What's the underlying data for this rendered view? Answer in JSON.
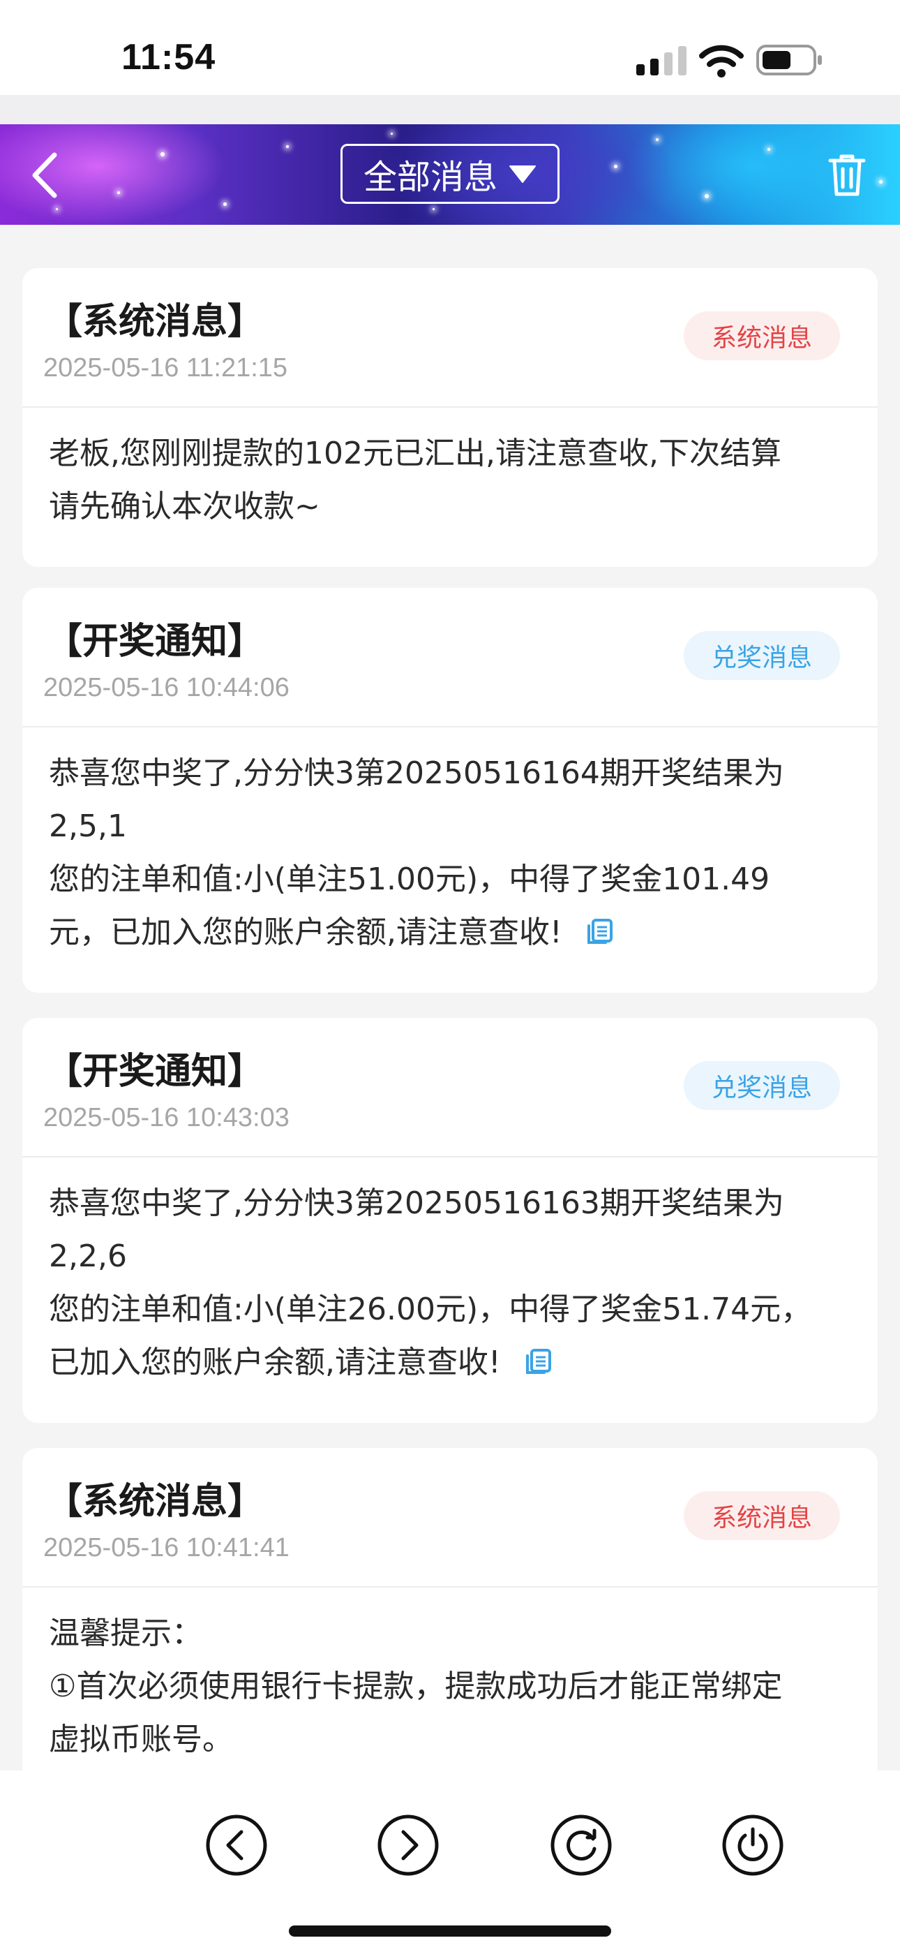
{
  "status_bar": {
    "time": "11:54",
    "signal_icon": "cellular-signal-icon",
    "wifi_icon": "wifi-icon",
    "battery_icon": "battery-icon"
  },
  "header": {
    "back_icon": "chevron-left-icon",
    "filter_label": "全部消息",
    "filter_icon": "caret-down-icon",
    "delete_icon": "trash-icon"
  },
  "messages": [
    {
      "title": "【系统消息】",
      "date": "2025-05-16 11:21:15",
      "badge": "系统消息",
      "badge_type": "system",
      "lines": [
        "老板,您刚刚提款的102元已汇出,请注意查收,下次结算",
        "请先确认本次收款~"
      ]
    },
    {
      "title": "【开奖通知】",
      "date": "2025-05-16 10:44:06",
      "badge": "兑奖消息",
      "badge_type": "prize",
      "lines": [
        "恭喜您中奖了,分分快3第20250516164期开奖结果为",
        "2,5,1",
        "您的注单和值:小(单注51.00元)，中得了奖金101.49",
        "元，已加入您的账户余额,请注意查收!"
      ]
    },
    {
      "title": "【开奖通知】",
      "date": "2025-05-16 10:43:03",
      "badge": "兑奖消息",
      "badge_type": "prize",
      "lines": [
        "恭喜您中奖了,分分快3第20250516163期开奖结果为",
        "2,2,6",
        "您的注单和值:小(单注26.00元)，中得了奖金51.74元，",
        "已加入您的账户余额,请注意查收!"
      ]
    },
    {
      "title": "【系统消息】",
      "date": "2025-05-16 10:41:41",
      "badge": "系统消息",
      "badge_type": "system",
      "lines": [
        "温馨提示：",
        "①首次必须使用银行卡提款，提款成功后才能正常绑定",
        "虚拟币账号。"
      ]
    }
  ],
  "toolbar": {
    "back_icon": "circle-chevron-left-icon",
    "forward_icon": "circle-chevron-right-icon",
    "refresh_icon": "refresh-icon",
    "power_icon": "power-icon"
  },
  "colors": {
    "system_badge_text": "#e24545",
    "system_badge_bg": "#fdeeee",
    "prize_badge_text": "#3aa3e4",
    "prize_badge_bg": "#eaf5fd",
    "copy_icon": "#3aa3e4"
  }
}
